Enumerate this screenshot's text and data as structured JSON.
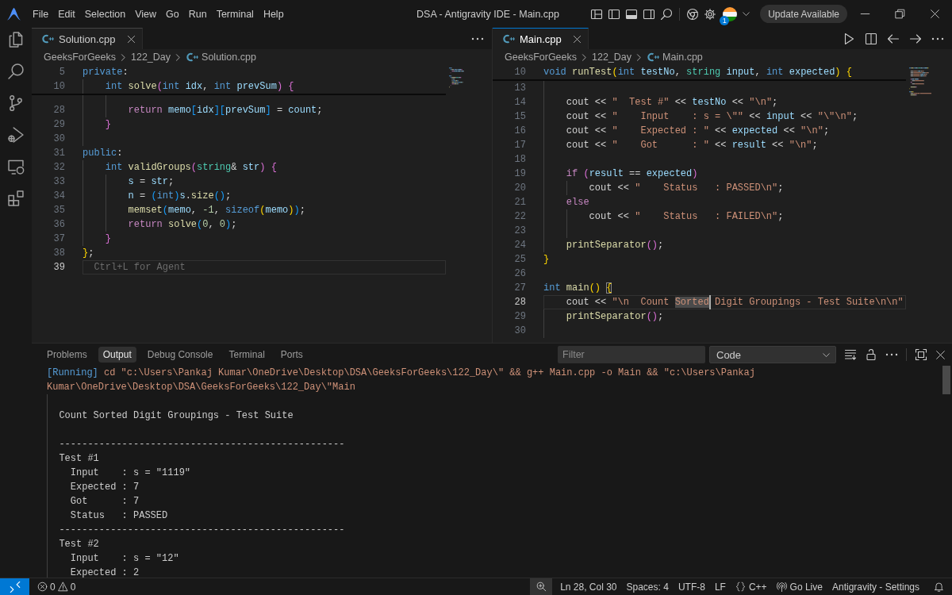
{
  "title_bar": {
    "menu": [
      "File",
      "Edit",
      "Selection",
      "View",
      "Go",
      "Run",
      "Terminal",
      "Help"
    ],
    "title": "DSA - Antigravity IDE - Main.cpp",
    "account_badge": "1",
    "update_button": "Update Available"
  },
  "editor_groups": [
    {
      "focused": false,
      "tabs": [
        {
          "label": "Solution.cpp",
          "selected": true
        }
      ],
      "breadcrumb": [
        {
          "kind": "folder",
          "label": "GeeksForGeeks"
        },
        {
          "kind": "folder",
          "label": "122_Day"
        },
        {
          "kind": "file",
          "label": "Solution.cpp"
        }
      ],
      "partial_first_line": true,
      "sticky_lines": [
        {
          "number": "5",
          "tokens": [
            {
              "kind": "kw",
              "text": "private"
            },
            {
              "kind": "p",
              "text": ":"
            }
          ]
        },
        {
          "number": "10",
          "tokens": [
            {
              "kind": "kw",
              "text": "    int "
            },
            {
              "kind": "fn",
              "text": "solve"
            },
            {
              "kind": "b2",
              "text": "("
            },
            {
              "kind": "kw",
              "text": "int "
            },
            {
              "kind": "var",
              "text": "idx"
            },
            {
              "kind": "p",
              "text": ", "
            },
            {
              "kind": "kw",
              "text": "int "
            },
            {
              "kind": "var",
              "text": "prevSum"
            },
            {
              "kind": "b2",
              "text": ") {"
            }
          ]
        }
      ],
      "lines": [
        {
          "number": "28",
          "current": false,
          "tokens": [
            {
              "kind": "ctl",
              "text": "        return "
            },
            {
              "kind": "var",
              "text": "memo"
            },
            {
              "kind": "b3",
              "text": "["
            },
            {
              "kind": "var",
              "text": "idx"
            },
            {
              "kind": "b3",
              "text": "]["
            },
            {
              "kind": "var",
              "text": "prevSum"
            },
            {
              "kind": "b3",
              "text": "]"
            },
            {
              "kind": "p",
              "text": " = "
            },
            {
              "kind": "var",
              "text": "count"
            },
            {
              "kind": "p",
              "text": ";"
            }
          ]
        },
        {
          "number": "29",
          "current": false,
          "tokens": [
            {
              "kind": "b2",
              "text": "    }"
            }
          ]
        },
        {
          "number": "30",
          "current": false
        },
        {
          "number": "31",
          "current": false,
          "tokens": [
            {
              "kind": "kw",
              "text": "public"
            },
            {
              "kind": "p",
              "text": ":"
            }
          ]
        },
        {
          "number": "32",
          "current": false,
          "tokens": [
            {
              "kind": "kw",
              "text": "    int "
            },
            {
              "kind": "fn",
              "text": "validGroups"
            },
            {
              "kind": "b2",
              "text": "("
            },
            {
              "kind": "type",
              "text": "string"
            },
            {
              "kind": "p",
              "text": "& "
            },
            {
              "kind": "var",
              "text": "str"
            },
            {
              "kind": "b2",
              "text": ") {"
            }
          ]
        },
        {
          "number": "33",
          "current": false,
          "tokens": [
            {
              "kind": "var",
              "text": "        s"
            },
            {
              "kind": "p",
              "text": " = "
            },
            {
              "kind": "var",
              "text": "str"
            },
            {
              "kind": "p",
              "text": ";"
            }
          ]
        },
        {
          "number": "34",
          "current": false,
          "tokens": [
            {
              "kind": "var",
              "text": "        n"
            },
            {
              "kind": "p",
              "text": " = "
            },
            {
              "kind": "b3",
              "text": "("
            },
            {
              "kind": "kw",
              "text": "int"
            },
            {
              "kind": "b3",
              "text": ")"
            },
            {
              "kind": "var",
              "text": "s"
            },
            {
              "kind": "p",
              "text": "."
            },
            {
              "kind": "fn",
              "text": "size"
            },
            {
              "kind": "b3",
              "text": "()"
            },
            {
              "kind": "p",
              "text": ";"
            }
          ]
        },
        {
          "number": "35",
          "current": false,
          "tokens": [
            {
              "kind": "fn",
              "text": "        memset"
            },
            {
              "kind": "b3",
              "text": "("
            },
            {
              "kind": "var",
              "text": "memo"
            },
            {
              "kind": "p",
              "text": ", "
            },
            {
              "kind": "num",
              "text": "-1"
            },
            {
              "kind": "p",
              "text": ", "
            },
            {
              "kind": "kw",
              "text": "sizeof"
            },
            {
              "kind": "b1",
              "text": "("
            },
            {
              "kind": "var",
              "text": "memo"
            },
            {
              "kind": "b1",
              "text": ")"
            },
            {
              "kind": "b3",
              "text": ")"
            },
            {
              "kind": "p",
              "text": ";"
            }
          ]
        },
        {
          "number": "36",
          "current": false,
          "tokens": [
            {
              "kind": "ctl",
              "text": "        return "
            },
            {
              "kind": "fn",
              "text": "solve"
            },
            {
              "kind": "b3",
              "text": "("
            },
            {
              "kind": "num",
              "text": "0"
            },
            {
              "kind": "p",
              "text": ", "
            },
            {
              "kind": "num",
              "text": "0"
            },
            {
              "kind": "b3",
              "text": ")"
            },
            {
              "kind": "p",
              "text": ";"
            }
          ]
        },
        {
          "number": "37",
          "current": false,
          "tokens": [
            {
              "kind": "b2",
              "text": "    }"
            }
          ]
        },
        {
          "number": "38",
          "current": false,
          "tokens": [
            {
              "kind": "b1",
              "text": "}"
            },
            {
              "kind": "p",
              "text": ";"
            }
          ]
        },
        {
          "number": "39",
          "current": true,
          "hint": "Ctrl+L for Agent"
        }
      ]
    },
    {
      "focused": true,
      "tabs": [
        {
          "label": "Main.cpp",
          "selected": true
        }
      ],
      "breadcrumb": [
        {
          "kind": "folder",
          "label": "GeeksForGeeks"
        },
        {
          "kind": "folder",
          "label": "122_Day"
        },
        {
          "kind": "file",
          "label": "Main.cpp"
        }
      ],
      "partial_first_line": false,
      "sticky_lines": [
        {
          "number": "10",
          "tokens": [
            {
              "kind": "kw",
              "text": "void "
            },
            {
              "kind": "fn",
              "text": "runTest"
            },
            {
              "kind": "b1",
              "text": "("
            },
            {
              "kind": "kw",
              "text": "int "
            },
            {
              "kind": "var",
              "text": "testNo"
            },
            {
              "kind": "p",
              "text": ", "
            },
            {
              "kind": "type",
              "text": "string "
            },
            {
              "kind": "var",
              "text": "input"
            },
            {
              "kind": "p",
              "text": ", "
            },
            {
              "kind": "kw",
              "text": "int "
            },
            {
              "kind": "var",
              "text": "expected"
            },
            {
              "kind": "b1",
              "text": ") {"
            }
          ]
        }
      ],
      "lines": [
        {
          "number": "13",
          "current": false
        },
        {
          "number": "14",
          "current": false,
          "tokens": [
            {
              "kind": "p",
              "text": "    cout << "
            },
            {
              "kind": "str",
              "text": "\"  Test #\""
            },
            {
              "kind": "p",
              "text": " << "
            },
            {
              "kind": "var",
              "text": "testNo"
            },
            {
              "kind": "p",
              "text": " << "
            },
            {
              "kind": "str",
              "text": "\"\\n\""
            },
            {
              "kind": "p",
              "text": ";"
            }
          ]
        },
        {
          "number": "15",
          "current": false,
          "tokens": [
            {
              "kind": "p",
              "text": "    cout << "
            },
            {
              "kind": "str",
              "text": "\"    Input    : s = \\\"\""
            },
            {
              "kind": "p",
              "text": " << "
            },
            {
              "kind": "var",
              "text": "input"
            },
            {
              "kind": "p",
              "text": " << "
            },
            {
              "kind": "str",
              "text": "\"\\\"\\n\""
            },
            {
              "kind": "p",
              "text": ";"
            }
          ]
        },
        {
          "number": "16",
          "current": false,
          "tokens": [
            {
              "kind": "p",
              "text": "    cout << "
            },
            {
              "kind": "str",
              "text": "\"    Expected : \""
            },
            {
              "kind": "p",
              "text": " << "
            },
            {
              "kind": "var",
              "text": "expected"
            },
            {
              "kind": "p",
              "text": " << "
            },
            {
              "kind": "str",
              "text": "\"\\n\""
            },
            {
              "kind": "p",
              "text": ";"
            }
          ]
        },
        {
          "number": "17",
          "current": false,
          "tokens": [
            {
              "kind": "p",
              "text": "    cout << "
            },
            {
              "kind": "str",
              "text": "\"    Got      : \""
            },
            {
              "kind": "p",
              "text": " << "
            },
            {
              "kind": "var",
              "text": "result"
            },
            {
              "kind": "p",
              "text": " << "
            },
            {
              "kind": "str",
              "text": "\"\\n\""
            },
            {
              "kind": "p",
              "text": ";"
            }
          ]
        },
        {
          "number": "18",
          "current": false
        },
        {
          "number": "19",
          "current": false,
          "tokens": [
            {
              "kind": "ctl",
              "text": "    if "
            },
            {
              "kind": "b2",
              "text": "("
            },
            {
              "kind": "var",
              "text": "result"
            },
            {
              "kind": "p",
              "text": " == "
            },
            {
              "kind": "var",
              "text": "expected"
            },
            {
              "kind": "b2",
              "text": ")"
            }
          ]
        },
        {
          "number": "20",
          "current": false,
          "tokens": [
            {
              "kind": "p",
              "text": "        cout << "
            },
            {
              "kind": "str",
              "text": "\"    Status   : PASSED\\n\""
            },
            {
              "kind": "p",
              "text": ";"
            }
          ]
        },
        {
          "number": "21",
          "current": false,
          "tokens": [
            {
              "kind": "ctl",
              "text": "    else"
            }
          ]
        },
        {
          "number": "22",
          "current": false,
          "tokens": [
            {
              "kind": "p",
              "text": "        cout << "
            },
            {
              "kind": "str",
              "text": "\"    Status   : FAILED\\n\""
            },
            {
              "kind": "p",
              "text": ";"
            }
          ]
        },
        {
          "number": "23",
          "current": false
        },
        {
          "number": "24",
          "current": false,
          "tokens": [
            {
              "kind": "fn",
              "text": "    printSeparator"
            },
            {
              "kind": "b2",
              "text": "()"
            },
            {
              "kind": "p",
              "text": ";"
            }
          ]
        },
        {
          "number": "25",
          "current": false,
          "tokens": [
            {
              "kind": "b1",
              "text": "}"
            }
          ]
        },
        {
          "number": "26",
          "current": false
        },
        {
          "number": "27",
          "current": false,
          "tokens": [
            {
              "kind": "kw",
              "text": "int "
            },
            {
              "kind": "fn",
              "text": "main"
            },
            {
              "kind": "b1",
              "text": "() "
            },
            {
              "kind": "b1-match",
              "text": "{"
            }
          ]
        },
        {
          "number": "28",
          "current": true,
          "tokens": [
            {
              "kind": "p",
              "text": "    cout << "
            },
            {
              "kind": "str",
              "text": "\"\\n  Count "
            },
            {
              "kind": "str-match",
              "text": "Sorted"
            },
            {
              "kind": "str",
              "text": " Digit Groupings - Test Suite\\n\\n\""
            }
          ]
        },
        {
          "number": "29",
          "current": false,
          "tokens": [
            {
              "kind": "fn",
              "text": "    printSeparator"
            },
            {
              "kind": "b2",
              "text": "()"
            },
            {
              "kind": "p",
              "text": ";"
            }
          ]
        },
        {
          "number": "30",
          "current": false
        }
      ]
    }
  ],
  "panel": {
    "tabs": [
      {
        "label": "Problems",
        "selected": false
      },
      {
        "label": "Output",
        "selected": true
      },
      {
        "label": "Debug Console",
        "selected": false
      },
      {
        "label": "Terminal",
        "selected": false
      },
      {
        "label": "Ports",
        "selected": false
      }
    ],
    "filter": {
      "placeholder": "Filter"
    },
    "channel": "Code",
    "output": {
      "status": "[Running]",
      "command": "cd \"c:\\Users\\Pankaj Kumar\\OneDrive\\Desktop\\DSA\\GeeksForGeeks\\122_Day\\\" && g++ Main.cpp -o Main && \"c:\\Users\\Pankaj Kumar\\OneDrive\\Desktop\\DSA\\GeeksForGeeks\\122_Day\\\"Main",
      "blocks": [
        [
          "  Count Sorted Digit Groupings - Test Suite"
        ],
        [
          "  --------------------------------------------------",
          "  Test #1",
          "    Input    : s = \"1119\"",
          "    Expected : 7",
          "    Got      : 7",
          "    Status   : PASSED",
          "  --------------------------------------------------",
          "  Test #2",
          "    Input    : s = \"12\"",
          "    Expected : 2"
        ]
      ]
    }
  },
  "status_bar": {
    "errors": "0",
    "warnings": "0",
    "items": [
      {
        "kind": "text",
        "label": "Ln 28, Col 30"
      },
      {
        "kind": "text",
        "label": "Spaces: 4"
      },
      {
        "kind": "text",
        "label": "UTF-8"
      },
      {
        "kind": "text",
        "label": "LF"
      },
      {
        "kind": "language",
        "label": "C++"
      },
      {
        "kind": "live",
        "label": "Go Live"
      },
      {
        "kind": "text",
        "label": "Antigravity - Settings"
      }
    ]
  }
}
